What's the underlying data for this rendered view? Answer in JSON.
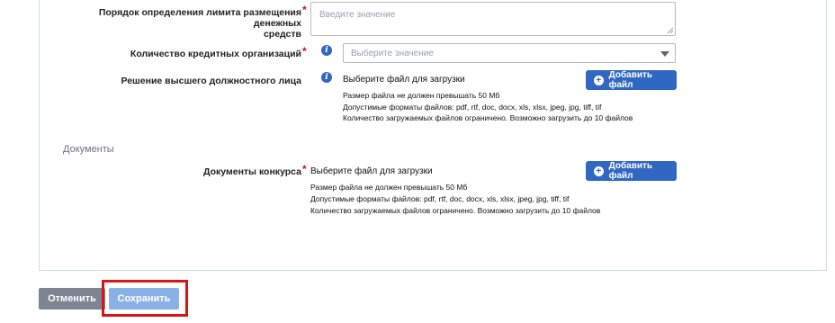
{
  "limit_order": {
    "label_line1": "Порядок определения лимита размещения денежных",
    "label_line2": "средств",
    "required_mark": "*",
    "placeholder": "Введите значение"
  },
  "credit_orgs": {
    "label": "Количество кредитных организаций",
    "required_mark": "*",
    "select_placeholder": "Выберите значение",
    "info_icon": "info-icon"
  },
  "decision": {
    "label": "Решение высшего должностного лица",
    "info_icon": "info-icon",
    "upload_title": "Выберите файл для загрузки",
    "add_button": "Добавить файл",
    "hint_size": "Размер файла не должен превышать 50 Мб",
    "hint_formats": "Допустимые форматы файлов: pdf, rtf, doc, docx, xls, xlsx, jpeg, jpg, tiff, tif",
    "hint_count": "Количество загружаемых файлов ограничено. Возможно загрузить до 10 файлов"
  },
  "documents_section": {
    "title": "Документы"
  },
  "contest_docs": {
    "label": "Документы конкурса",
    "required_mark": "*",
    "upload_title": "Выберите файл для загрузки",
    "add_button": "Добавить файл",
    "hint_size": "Размер файла не должен превышать 50 Мб",
    "hint_formats": "Допустимые форматы файлов: pdf, rtf, doc, docx, xls, xlsx, jpeg, jpg, tiff, tif",
    "hint_count": "Количество загружаемых файлов ограничено. Возможно загрузить до 10 файлов"
  },
  "footer": {
    "cancel_label": "Отменить",
    "save_label": "Сохранить"
  },
  "colors": {
    "primary": "#2f67c2",
    "required": "#c8102e",
    "highlight": "#d8141b",
    "save_disabled": "#8ab1e6",
    "cancel": "#7c8591"
  }
}
